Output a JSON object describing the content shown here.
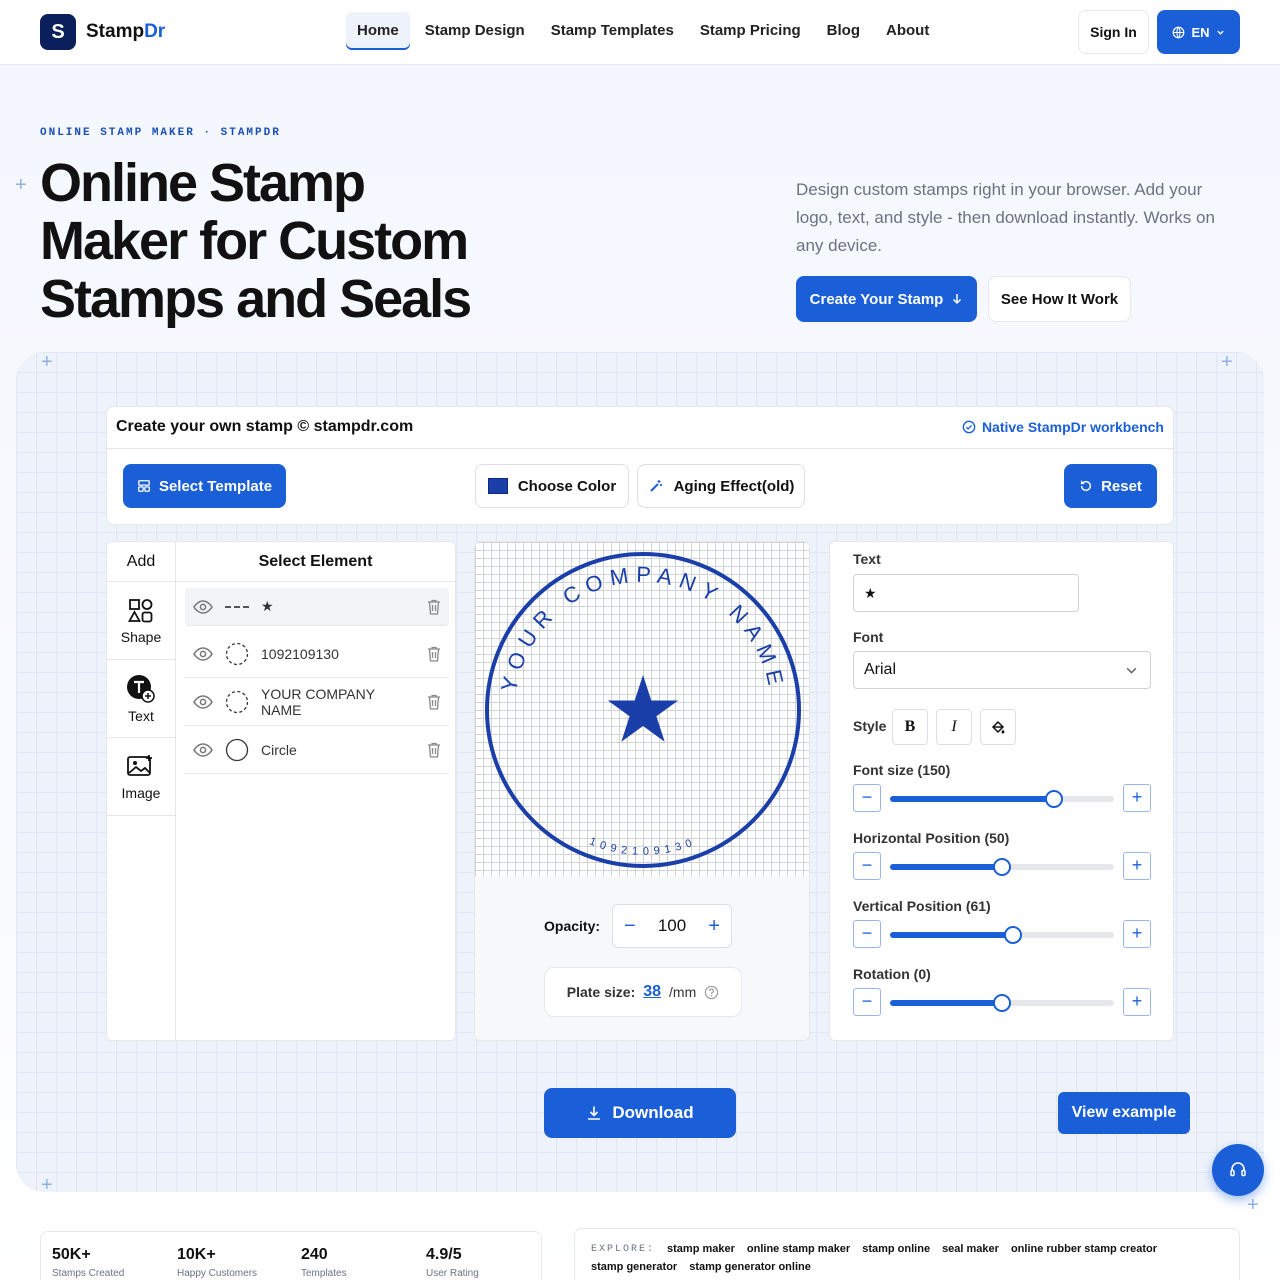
{
  "header": {
    "logo_glyph": "S",
    "brand_a": "Stamp",
    "brand_b": "Dr",
    "nav": [
      "Home",
      "Stamp Design",
      "Stamp Templates",
      "Stamp Pricing",
      "Blog",
      "About"
    ],
    "signin": "Sign In",
    "lang": "EN"
  },
  "hero": {
    "eyebrow": "ONLINE STAMP MAKER · STAMPDR",
    "title": "Online Stamp Maker for Custom Stamps and Seals",
    "lead": "Design custom stamps right in your browser. Add your logo, text, and style - then download instantly. Works on any device.",
    "cta_primary": "Create Your Stamp",
    "cta_secondary": "See How It Work"
  },
  "workbench": {
    "title": "Create your own stamp © stampdr.com",
    "native": "Native StampDr workbench",
    "select_template": "Select Template",
    "choose_color": "Choose Color",
    "aging": "Aging Effect(old)",
    "reset": "Reset",
    "color": "#1a3fa8"
  },
  "left_panel": {
    "add_head": "Add",
    "select_head": "Select Element",
    "add_items": [
      "Shape",
      "Text",
      "Image"
    ],
    "elements": [
      "★",
      "1092109130",
      "YOUR COMPANY NAME",
      "Circle"
    ]
  },
  "stamp": {
    "top_text": "YOUR COMPANY NAME",
    "bottom_text": "1092109130",
    "center": "★"
  },
  "canvas_controls": {
    "opacity_label": "Opacity:",
    "opacity": "100",
    "plate_label": "Plate size:",
    "plate_value": "38",
    "plate_unit": "/mm"
  },
  "props": {
    "text_label": "Text",
    "text_value": "★",
    "font_label": "Font",
    "font_value": "Arial",
    "style_label": "Style",
    "sliders": [
      {
        "label": "Font size (150)",
        "fraction": 0.73
      },
      {
        "label": "Horizontal Position (50)",
        "fraction": 0.5
      },
      {
        "label": "Vertical Position (61)",
        "fraction": 0.55
      },
      {
        "label": "Rotation (0)",
        "fraction": 0.5
      }
    ]
  },
  "actions": {
    "download": "Download",
    "view_example": "View example"
  },
  "stats": [
    {
      "value": "50K+",
      "label": "Stamps Created"
    },
    {
      "value": "10K+",
      "label": "Happy Customers"
    },
    {
      "value": "240",
      "label": "Templates"
    },
    {
      "value": "4.9/5",
      "label": "User Rating"
    }
  ],
  "explore": {
    "label": "EXPLORE:",
    "links": [
      "stamp maker",
      "online stamp maker",
      "stamp online",
      "seal maker",
      "online rubber stamp creator",
      "stamp generator",
      "stamp generator online"
    ]
  }
}
